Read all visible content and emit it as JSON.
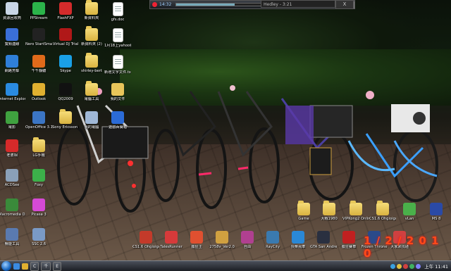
{
  "player": {
    "time": "14:32",
    "track": "Hedley - 3:21",
    "progress": 0.35
  },
  "hedley_tab": "Hedley - 3:21",
  "close_symbol": "Ⅹ",
  "date_stamp": "1 / 2 / 2 0 1 0",
  "desktop_icons": [
    {
      "label": "資源回收筒",
      "icon": "recycle-bin-icon",
      "color": "#c9d6e6",
      "type": "app"
    },
    {
      "label": "PPStream",
      "icon": "ppstream-icon",
      "color": "#2bb34a",
      "type": "app"
    },
    {
      "label": "FlashFXP",
      "icon": "flashfxp-icon",
      "color": "#d32b2b",
      "type": "app"
    },
    {
      "label": "新資料夾",
      "icon": "folder-icon",
      "color": "#e8c55a",
      "type": "folder"
    },
    {
      "label": "gfs.doc",
      "icon": "document-icon",
      "color": "#ffffff",
      "type": "doc"
    },
    {
      "label": "寬頻連線",
      "icon": "network-icon",
      "color": "#3a6fd8",
      "type": "app"
    },
    {
      "label": "Nero StartSmart",
      "icon": "nero-icon",
      "color": "#222222",
      "type": "app"
    },
    {
      "label": "Virtual DJ Trial",
      "icon": "virtualdj-icon",
      "color": "#b01818",
      "type": "app"
    },
    {
      "label": "新資料夾 (2)",
      "icon": "folder-icon",
      "color": "#e8c55a",
      "type": "folder"
    },
    {
      "label": "1月18上yahoo看旨",
      "icon": "document-icon",
      "color": "#ffffff",
      "type": "doc"
    },
    {
      "label": "網路芳鄰",
      "icon": "network-places-icon",
      "color": "#2f7fd8",
      "type": "app"
    },
    {
      "label": "千千靜聽",
      "icon": "ttplayer-icon",
      "color": "#e06a1a",
      "type": "app"
    },
    {
      "label": "Skype",
      "icon": "skype-icon",
      "color": "#1aa0e6",
      "type": "app"
    },
    {
      "label": "shirley-bert",
      "icon": "folder-icon",
      "color": "#e8c55a",
      "type": "folder"
    },
    {
      "label": "新增文字文件.txt",
      "icon": "document-icon",
      "color": "#ffffff",
      "type": "doc"
    },
    {
      "label": "Internet Explorer",
      "icon": "ie-icon",
      "color": "#2a8be0",
      "type": "app"
    },
    {
      "label": "Outlook",
      "icon": "outlook-icon",
      "color": "#e0b030",
      "type": "app"
    },
    {
      "label": "QQ2009",
      "icon": "qq-icon",
      "color": "#111111",
      "type": "app"
    },
    {
      "label": "電腦工具",
      "icon": "folder-icon",
      "color": "#e8c55a",
      "type": "folder"
    },
    {
      "label": "我的文件",
      "icon": "my-documents-icon",
      "color": "#e8c55a",
      "type": "app"
    },
    {
      "label": "電影",
      "icon": "movie-icon",
      "color": "#3fa23f",
      "type": "app"
    },
    {
      "label": "OpenOffice 3.1",
      "icon": "openoffice-icon",
      "color": "#3b75c4",
      "type": "app"
    },
    {
      "label": "Sony Ericsson PC Suite",
      "icon": "folder-icon",
      "color": "#e8c55a",
      "type": "folder"
    },
    {
      "label": "我的電腦",
      "icon": "my-computer-icon",
      "color": "#9fb7d6",
      "type": "app"
    },
    {
      "label": "遊戲百寶箱",
      "icon": "game-box-icon",
      "color": "#2b6bd6",
      "type": "app"
    },
    {
      "label": "老婆相",
      "icon": "photo-icon",
      "color": "#d62a2a",
      "type": "app"
    },
    {
      "label": "LG手機",
      "icon": "folder-icon",
      "color": "#e8c55a",
      "type": "folder"
    },
    {
      "label": "ACDSee",
      "icon": "acdsee-icon",
      "color": "#8aa0b8",
      "type": "app"
    },
    {
      "label": "Foxy",
      "icon": "foxy-icon",
      "color": "#3cb04a",
      "type": "app"
    },
    {
      "label": "Macromedia Dreamweaver",
      "icon": "dreamweaver-icon",
      "color": "#3a8a3a",
      "type": "app"
    },
    {
      "label": "Picasa 3",
      "icon": "picasa-icon",
      "color": "#d64ad6",
      "type": "app"
    },
    {
      "label": "暢遊工具",
      "icon": "tool-icon",
      "color": "#5a7ab0",
      "type": "app"
    },
    {
      "label": "SSC 2.6",
      "icon": "ssc-icon",
      "color": "#7a9ac6",
      "type": "app"
    }
  ],
  "bottom_icons": [
    {
      "label": "Game",
      "icon": "folder-icon",
      "color": "#e8c55a",
      "type": "folder"
    },
    {
      "label": "大戰1980",
      "icon": "folder-icon",
      "color": "#e8c55a",
      "type": "folder"
    },
    {
      "label": "VIPKong2 Online",
      "icon": "folder-icon",
      "color": "#e8c55a",
      "type": "folder"
    },
    {
      "label": "CS1.6 Ohgioigogs",
      "icon": "folder-icon",
      "color": "#e8c55a",
      "type": "folder"
    },
    {
      "label": "vLan",
      "icon": "vlan-icon",
      "color": "#4ab04a",
      "type": "app"
    },
    {
      "label": "MS 8",
      "icon": "ms-icon",
      "color": "#2a4aa6",
      "type": "app"
    },
    {
      "label": "CS1.6 Ohgioigogs",
      "icon": "cs-icon",
      "color": "#c43a2a",
      "type": "app"
    },
    {
      "label": "TalesRunner",
      "icon": "talesrunner-icon",
      "color": "#d63a3a",
      "type": "app"
    },
    {
      "label": "瘋狂主",
      "icon": "game-icon",
      "color": "#e05030",
      "type": "app"
    },
    {
      "label": "2758v_Ver2.0",
      "icon": "game-icon",
      "color": "#d0a040",
      "type": "app"
    },
    {
      "label": "自由",
      "icon": "game-icon",
      "color": "#b04090",
      "type": "app"
    },
    {
      "label": "RayCity",
      "icon": "raycity-icon",
      "color": "#3a7ab0",
      "type": "app"
    },
    {
      "label": "快樂飛車",
      "icon": "racing-icon",
      "color": "#2a88d6",
      "type": "app"
    },
    {
      "label": "GTA San Andreas",
      "icon": "gta-icon",
      "color": "#2a3040",
      "type": "app"
    },
    {
      "label": "瘋狂賽車",
      "icon": "racing-icon",
      "color": "#c02020",
      "type": "app"
    },
    {
      "label": "Frozen Throne",
      "icon": "warcraft-icon",
      "color": "#2a4a8a",
      "type": "app"
    },
    {
      "label": "大家來找碴",
      "icon": "game-icon",
      "color": "#d04040",
      "type": "app"
    }
  ],
  "taskbar": {
    "tasks": [
      "C",
      "千",
      "E"
    ],
    "clock": "上午 11:41"
  }
}
